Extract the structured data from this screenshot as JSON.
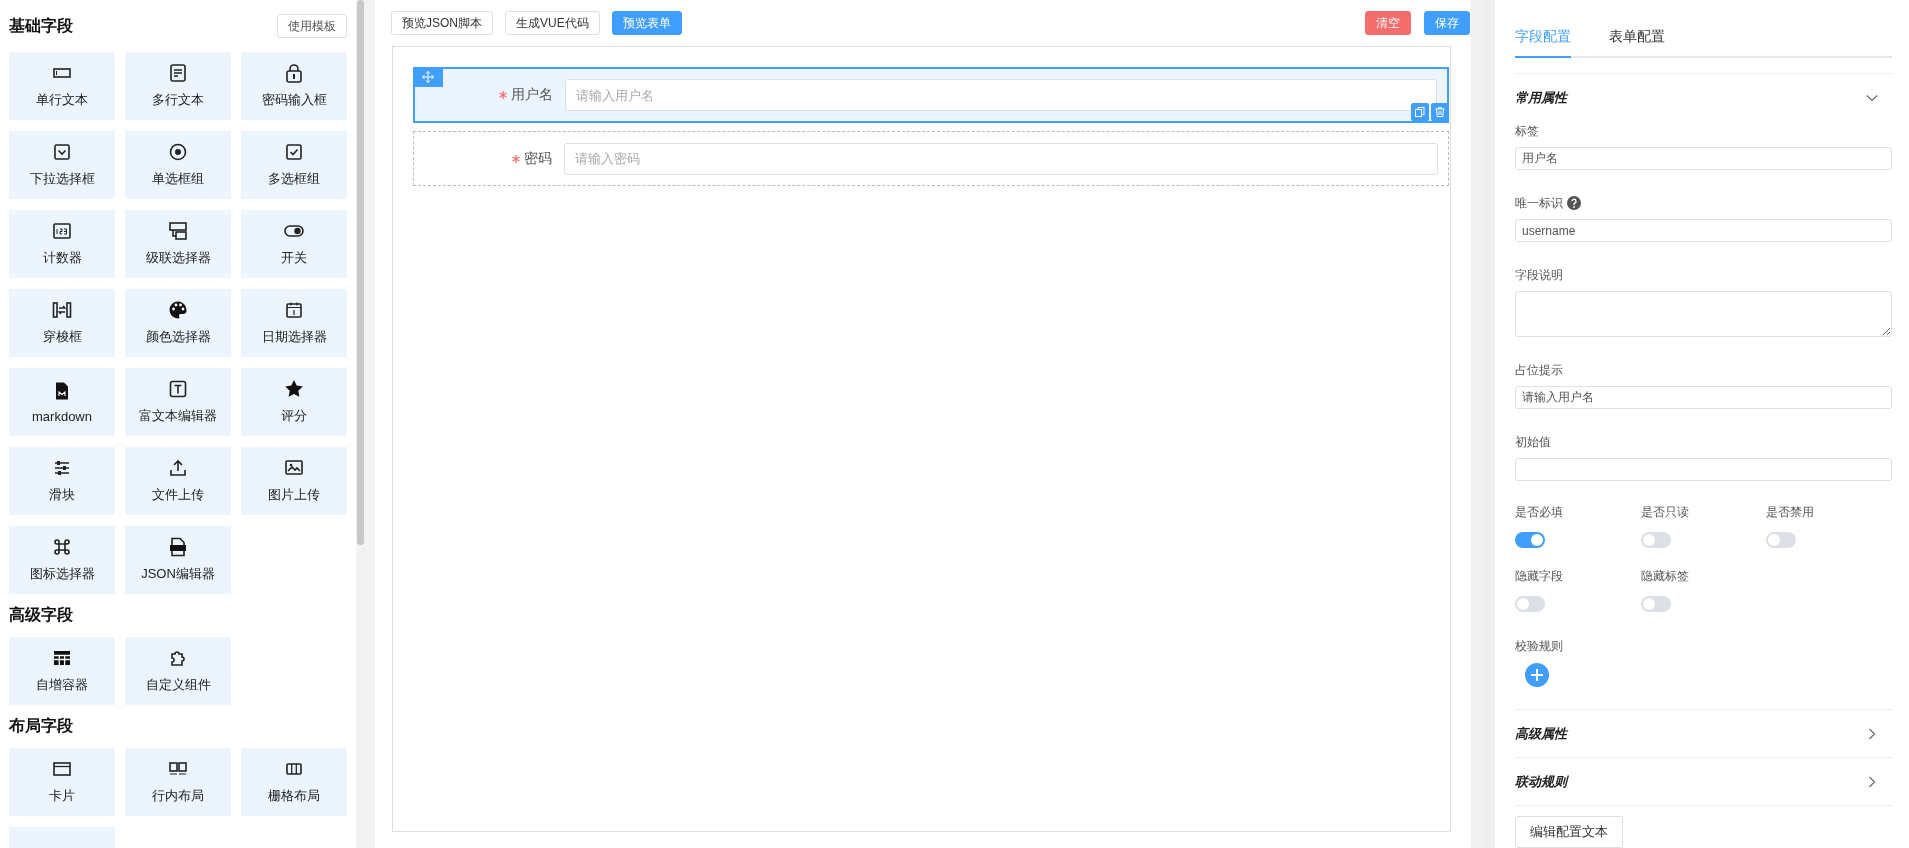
{
  "palette": {
    "template_button": "使用模板",
    "sections": [
      {
        "title": "基础字段",
        "items": [
          {
            "kind": "tile",
            "label": "单行文本"
          },
          {
            "kind": "tile",
            "label": "多行文本"
          },
          {
            "kind": "tile",
            "label": "密码输入框"
          },
          {
            "kind": "tile",
            "label": "下拉选择框"
          },
          {
            "kind": "tile",
            "label": "单选框组"
          },
          {
            "kind": "tile",
            "label": "多选框组"
          },
          {
            "kind": "tile",
            "label": "计数器"
          },
          {
            "kind": "tile",
            "label": "级联选择器"
          },
          {
            "kind": "tile",
            "label": "开关"
          },
          {
            "kind": "tile",
            "label": "穿梭框"
          },
          {
            "kind": "tile",
            "label": "颜色选择器"
          },
          {
            "kind": "tile",
            "label": "日期选择器"
          },
          {
            "kind": "tile",
            "label": "markdown"
          },
          {
            "kind": "tile",
            "label": "富文本编辑器"
          },
          {
            "kind": "tile",
            "label": "评分"
          },
          {
            "kind": "tile",
            "label": "滑块"
          },
          {
            "kind": "tile",
            "label": "文件上传"
          },
          {
            "kind": "tile",
            "label": "图片上传"
          },
          {
            "kind": "tile",
            "label": "图标选择器"
          },
          {
            "kind": "tile",
            "label": "JSON编辑器"
          }
        ]
      },
      {
        "title": "高级字段",
        "items": [
          {
            "kind": "tile",
            "label": "自增容器"
          },
          {
            "kind": "tile",
            "label": "自定义组件"
          }
        ]
      },
      {
        "title": "布局字段",
        "items": [
          {
            "kind": "tile",
            "label": "卡片"
          },
          {
            "kind": "tile",
            "label": "行内布局"
          },
          {
            "kind": "tile",
            "label": "栅格布局"
          },
          {
            "kind": "cut_off"
          }
        ]
      }
    ]
  },
  "toolbar": {
    "left_buttons": [
      {
        "label": "预览JSON脚本",
        "kind": "default"
      },
      {
        "label": "生成VUE代码",
        "kind": "default"
      },
      {
        "label": "预览表单",
        "kind": "primary"
      }
    ],
    "right_buttons": [
      {
        "label": "清空",
        "kind": "danger"
      },
      {
        "label": "保存",
        "kind": "primary"
      }
    ]
  },
  "canvas": {
    "fields": [
      {
        "label": "用户名",
        "required": true,
        "placeholder": "请输入用户名",
        "selected": true
      },
      {
        "label": "密码",
        "required": true,
        "placeholder": "请输入密码",
        "selected": false
      }
    ]
  },
  "settings": {
    "tabs": [
      {
        "label": "字段配置",
        "selected": true
      },
      {
        "label": "表单配置",
        "selected": false
      }
    ],
    "panels": [
      {
        "title": "常用属性",
        "expanded": true,
        "fields": [
          {
            "kind": "input",
            "label": "标签",
            "value": "用户名"
          },
          {
            "kind": "input",
            "label": "唯一标识",
            "help": true,
            "value": "username"
          },
          {
            "kind": "textarea",
            "label": "字段说明"
          },
          {
            "kind": "input",
            "label": "占位提示",
            "value": "请输入用户名"
          },
          {
            "kind": "input",
            "label": "初始值"
          }
        ],
        "switches": [
          {
            "label": "是否必填",
            "on": true
          },
          {
            "label": "是否只读",
            "on": false
          },
          {
            "label": "是否禁用",
            "on": false
          },
          {
            "label": "隐藏字段",
            "on": false
          },
          {
            "label": "隐藏标签",
            "on": false
          }
        ],
        "rules_label": "校验规则"
      },
      {
        "title": "高级属性",
        "expanded": false
      },
      {
        "title": "联动规则",
        "expanded": false
      }
    ],
    "edit_button": "编辑配置文本"
  }
}
